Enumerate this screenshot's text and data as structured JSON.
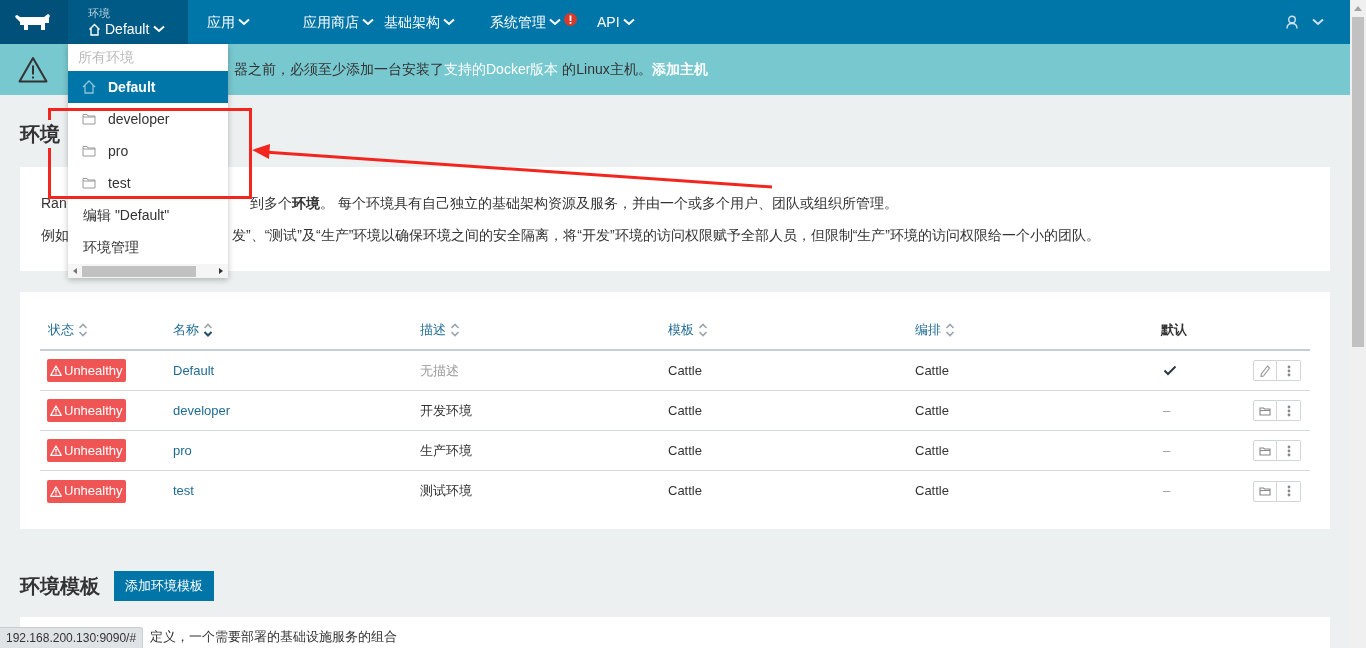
{
  "nav": {
    "env_label": "环境",
    "env_current": "Default",
    "menus": [
      {
        "label": "应用",
        "alert": false
      },
      {
        "label": "应用商店",
        "alert": false
      },
      {
        "label": "基础架构",
        "alert": false
      },
      {
        "label": "系统管理",
        "alert": true
      },
      {
        "label": "API",
        "alert": false
      }
    ]
  },
  "banner": {
    "text": "器之前，必须至少添加一台安装了",
    "link": "支持的Docker版本",
    "text_after": " 的Linux主机。",
    "action": "添加主机"
  },
  "env_menu": {
    "header": "所有环境",
    "items": [
      {
        "label": "Default",
        "kind": "home",
        "selected": true
      },
      {
        "label": "developer",
        "kind": "folder",
        "selected": false
      },
      {
        "label": "pro",
        "kind": "folder",
        "selected": false
      },
      {
        "label": "test",
        "kind": "folder",
        "selected": false
      }
    ],
    "actions": [
      "编辑 \"Default\"",
      "环境管理"
    ]
  },
  "page_title": "环境",
  "intro": [
    {
      "start": "Ran",
      "rest": "到多个**环境**。 每个环境具有自己独立的基础架构资源及服务，并由一个或多个用户、团队或组织所管理。"
    },
    {
      "start": "例如",
      "rest": "发”、“测试”及“生产”环境以确保环境之间的安全隔离，将“开发”环境的访问权限赋予全部人员，但限制“生产”环境的访问权限给一个小的团队。"
    }
  ],
  "table": {
    "columns": [
      {
        "label": "状态",
        "sortable": true,
        "sorted": false
      },
      {
        "label": "名称",
        "sortable": true,
        "sorted": true
      },
      {
        "label": "描述",
        "sortable": true,
        "sorted": false
      },
      {
        "label": "模板",
        "sortable": true,
        "sorted": false
      },
      {
        "label": "编排",
        "sortable": true,
        "sorted": false
      },
      {
        "label": "默认",
        "sortable": false
      }
    ],
    "rows": [
      {
        "state": "Unhealthy",
        "name": "Default",
        "description": "无描述",
        "muted": true,
        "template": "Cattle",
        "orchestration": "Cattle",
        "is_default": true,
        "kind": "edit"
      },
      {
        "state": "Unhealthy",
        "name": "developer",
        "description": "开发环境",
        "muted": false,
        "template": "Cattle",
        "orchestration": "Cattle",
        "is_default": false,
        "placeholder": "–",
        "kind": "switch"
      },
      {
        "state": "Unhealthy",
        "name": "pro",
        "description": "生产环境",
        "muted": false,
        "template": "Cattle",
        "orchestration": "Cattle",
        "is_default": false,
        "placeholder": "–",
        "kind": "switch"
      },
      {
        "state": "Unhealthy",
        "name": "test",
        "description": "测试环境",
        "muted": false,
        "template": "Cattle",
        "orchestration": "Cattle",
        "is_default": false,
        "placeholder": "–",
        "kind": "switch"
      }
    ]
  },
  "templates": {
    "title": "环境模板",
    "add_button": "添加环境模板",
    "description": "定义，一个需要部署的基础设施服务的组合"
  },
  "status_url": "192.168.200.130:9090/#"
}
